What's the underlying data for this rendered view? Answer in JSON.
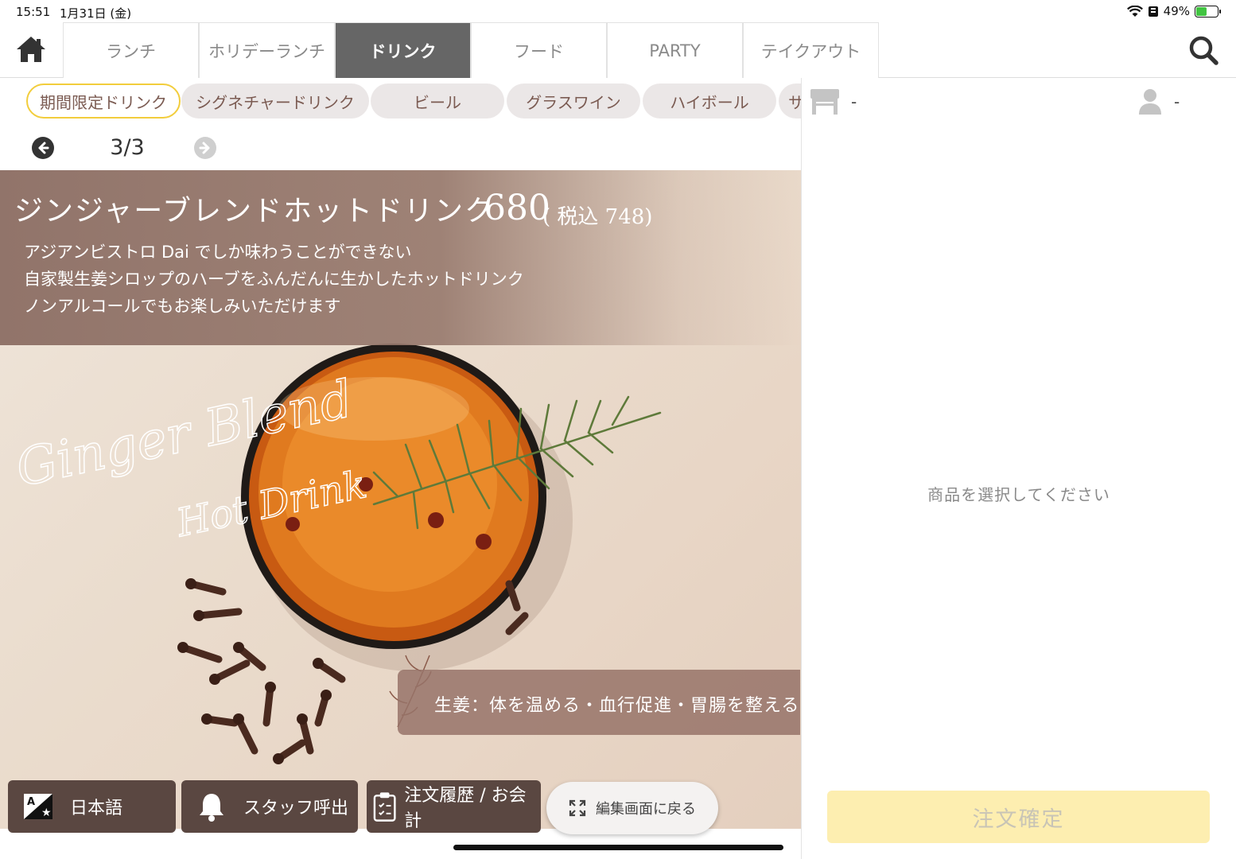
{
  "status_bar": {
    "time": "15:51",
    "date": "1月31日 (金)",
    "battery": "49%",
    "battery_level": 0.49
  },
  "nav": {
    "tabs": [
      {
        "label": "ランチ"
      },
      {
        "label": "ホリデーランチ"
      },
      {
        "label": "ドリンク",
        "active": true
      },
      {
        "label": "フード"
      },
      {
        "label": "PARTY"
      },
      {
        "label": "テイクアウト"
      }
    ]
  },
  "subcategories": [
    {
      "label": "期間限定ドリンク",
      "active": true
    },
    {
      "label": "シグネチャードリンク"
    },
    {
      "label": "ビール"
    },
    {
      "label": "グラスワイン"
    },
    {
      "label": "ハイボール"
    },
    {
      "label": "サ"
    }
  ],
  "pager": {
    "text": "3/3"
  },
  "item": {
    "name": "ジンジャーブレンドホットドリンク",
    "price": "680",
    "tax_price": "( 税込 748)",
    "description": [
      "アジアンビストロ Dai でしか味わうことができない",
      "自家製生姜シロップのハーブをふんだんに生かしたホットドリンク",
      "ノンアルコールでもお楽しみいただけます"
    ],
    "script_title": [
      "Ginger Blend",
      "Hot Drink"
    ],
    "effect": "生姜：体を温める・血行促進・胃腸を整える"
  },
  "bottom_buttons": {
    "language": "日本語",
    "staff_call": "スタッフ呼出",
    "history": "注文履歴 / お会計",
    "edit": "編集画面に戻る"
  },
  "order_panel": {
    "table_value": "-",
    "people_value": "-",
    "empty_message": "商品を選択してください",
    "confirm": "注文確定"
  },
  "colors": {
    "active_tab": "#666666",
    "pill_active_border": "#f2cd3c",
    "button_bg": "#5a4741",
    "confirm_bg": "#fdeeb0"
  },
  "icons": [
    "home-icon",
    "search-icon",
    "arrow-left-icon",
    "arrow-right-icon",
    "translate-icon",
    "bell-icon",
    "clipboard-icon",
    "expand-icon",
    "table-icon",
    "person-icon"
  ]
}
